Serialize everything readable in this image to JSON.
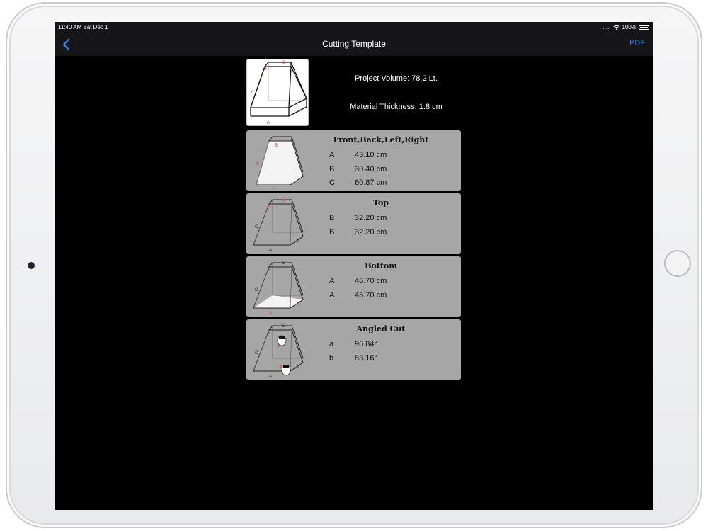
{
  "status": {
    "time": "11:40 AM  Sat Dec 1",
    "signal": ".....",
    "battery": "100%"
  },
  "nav": {
    "title": "Cutting Template",
    "pdf_label": "PDF"
  },
  "summary": {
    "volume": "Project Volume: 78.2 Lt.",
    "thickness": "Material Thickness: 1.8 cm",
    "diagram_labels": {
      "a": "A",
      "b": "B",
      "c": "C"
    }
  },
  "cards": [
    {
      "title": "Front,Back,Left,Right",
      "rows": [
        {
          "label": "A",
          "value": "43.10 cm"
        },
        {
          "label": "B",
          "value": "30.40 cm"
        },
        {
          "label": "C",
          "value": "60.87 cm"
        }
      ]
    },
    {
      "title": "Top",
      "rows": [
        {
          "label": "B",
          "value": "32.20 cm"
        },
        {
          "label": "B",
          "value": "32.20 cm"
        }
      ]
    },
    {
      "title": "Bottom",
      "rows": [
        {
          "label": "A",
          "value": "46.70 cm"
        },
        {
          "label": "A",
          "value": "46.70 cm"
        }
      ]
    },
    {
      "title": "Angled Cut",
      "rows": [
        {
          "label": "a",
          "value": "96.84°"
        },
        {
          "label": "b",
          "value": "83.16°"
        }
      ]
    }
  ],
  "colors": {
    "accent": "#2b7de9",
    "card_bg": "#a6a6a6",
    "label_red": "#d8342b"
  },
  "icons": {
    "back": "chevron-left-icon",
    "wifi": "wifi-icon",
    "battery": "battery-icon",
    "diagram": "frustum-box-icon"
  }
}
